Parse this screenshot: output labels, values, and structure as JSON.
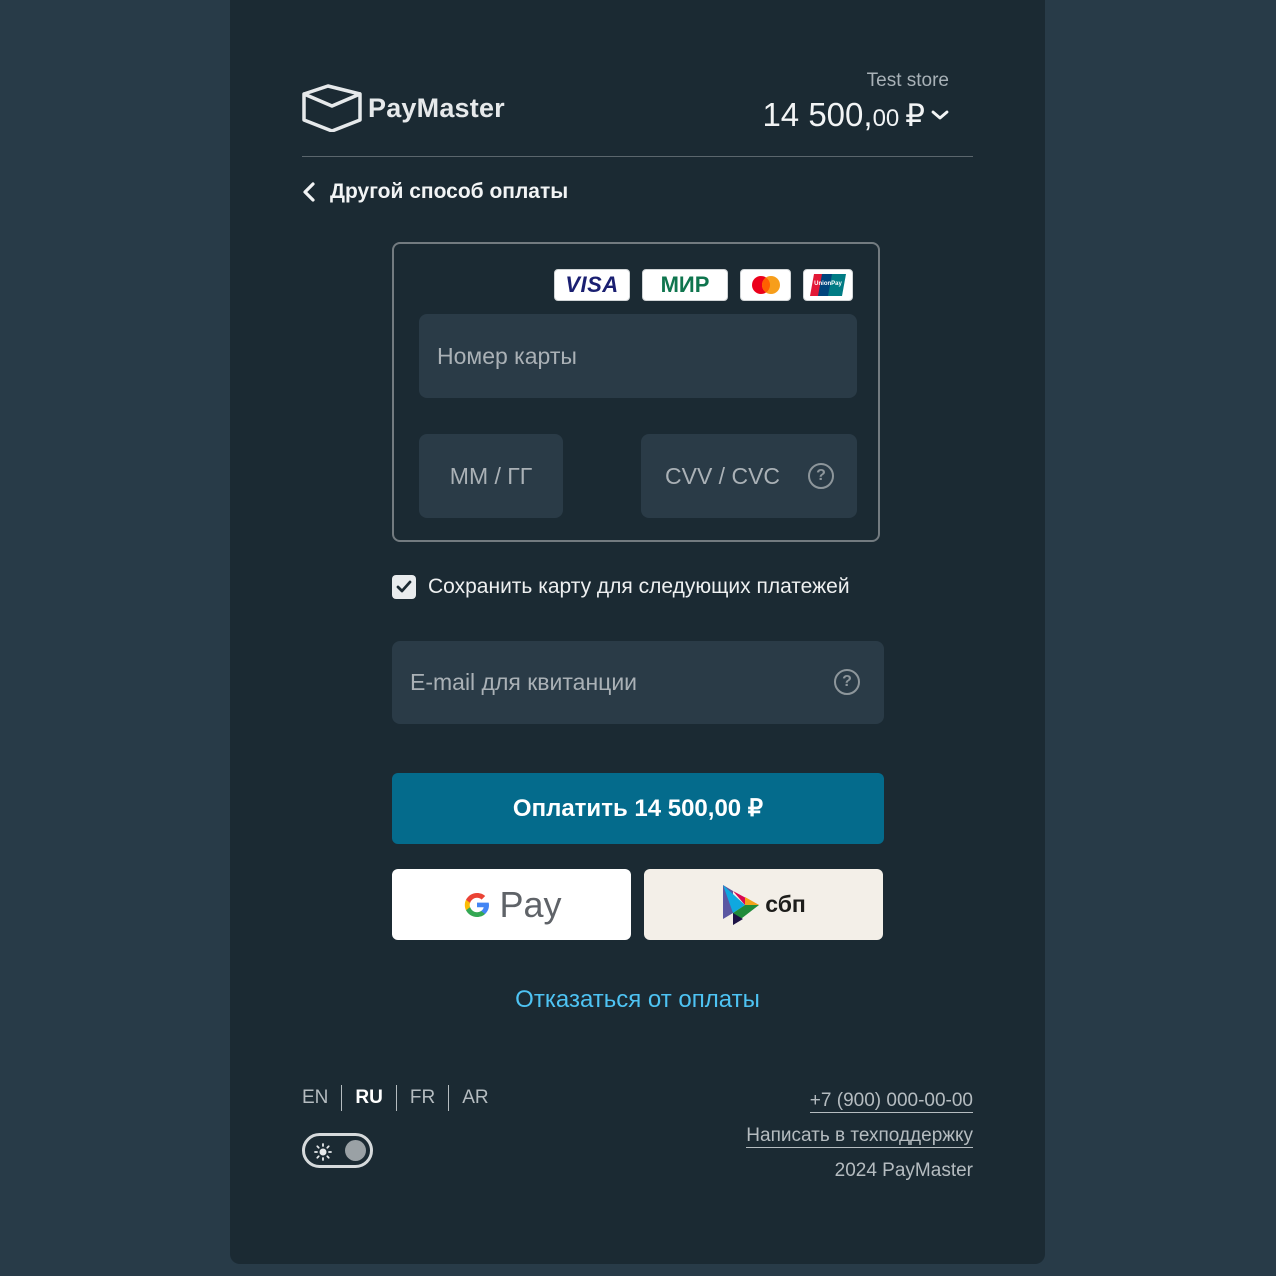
{
  "header": {
    "logo_text": "PayMaster",
    "store_name": "Test store",
    "amount_int": "14 500,",
    "amount_dec": "00",
    "currency": "₽"
  },
  "back": {
    "label": "Другой способ оплаты"
  },
  "card_form": {
    "brands": [
      "VISA",
      "МИР",
      "Mastercard",
      "UnionPay"
    ],
    "card_number_placeholder": "Номер карты",
    "expiry_placeholder": "ММ / ГГ",
    "cvv_placeholder": "CVV / CVC"
  },
  "save_card": {
    "label": "Сохранить карту для следующих платежей",
    "checked": true
  },
  "email": {
    "placeholder": "E-mail для квитанции"
  },
  "pay_button": {
    "label": "Оплатить 14 500,00 ₽"
  },
  "gpay": {
    "label": "Pay"
  },
  "sbp": {
    "label": "сбп"
  },
  "cancel": {
    "label": "Отказаться от оплаты"
  },
  "footer": {
    "languages": [
      "EN",
      "RU",
      "FR",
      "AR"
    ],
    "active_language": "RU",
    "phone": "+7 (900) 000-00-00",
    "support": "Написать в техподдержку",
    "copyright": "2024 PayMaster"
  },
  "colors": {
    "background": "#283b48",
    "card": "#1b2a33",
    "field": "#2a3b47",
    "primary_button": "#046b8c",
    "link": "#4ec3f3"
  }
}
